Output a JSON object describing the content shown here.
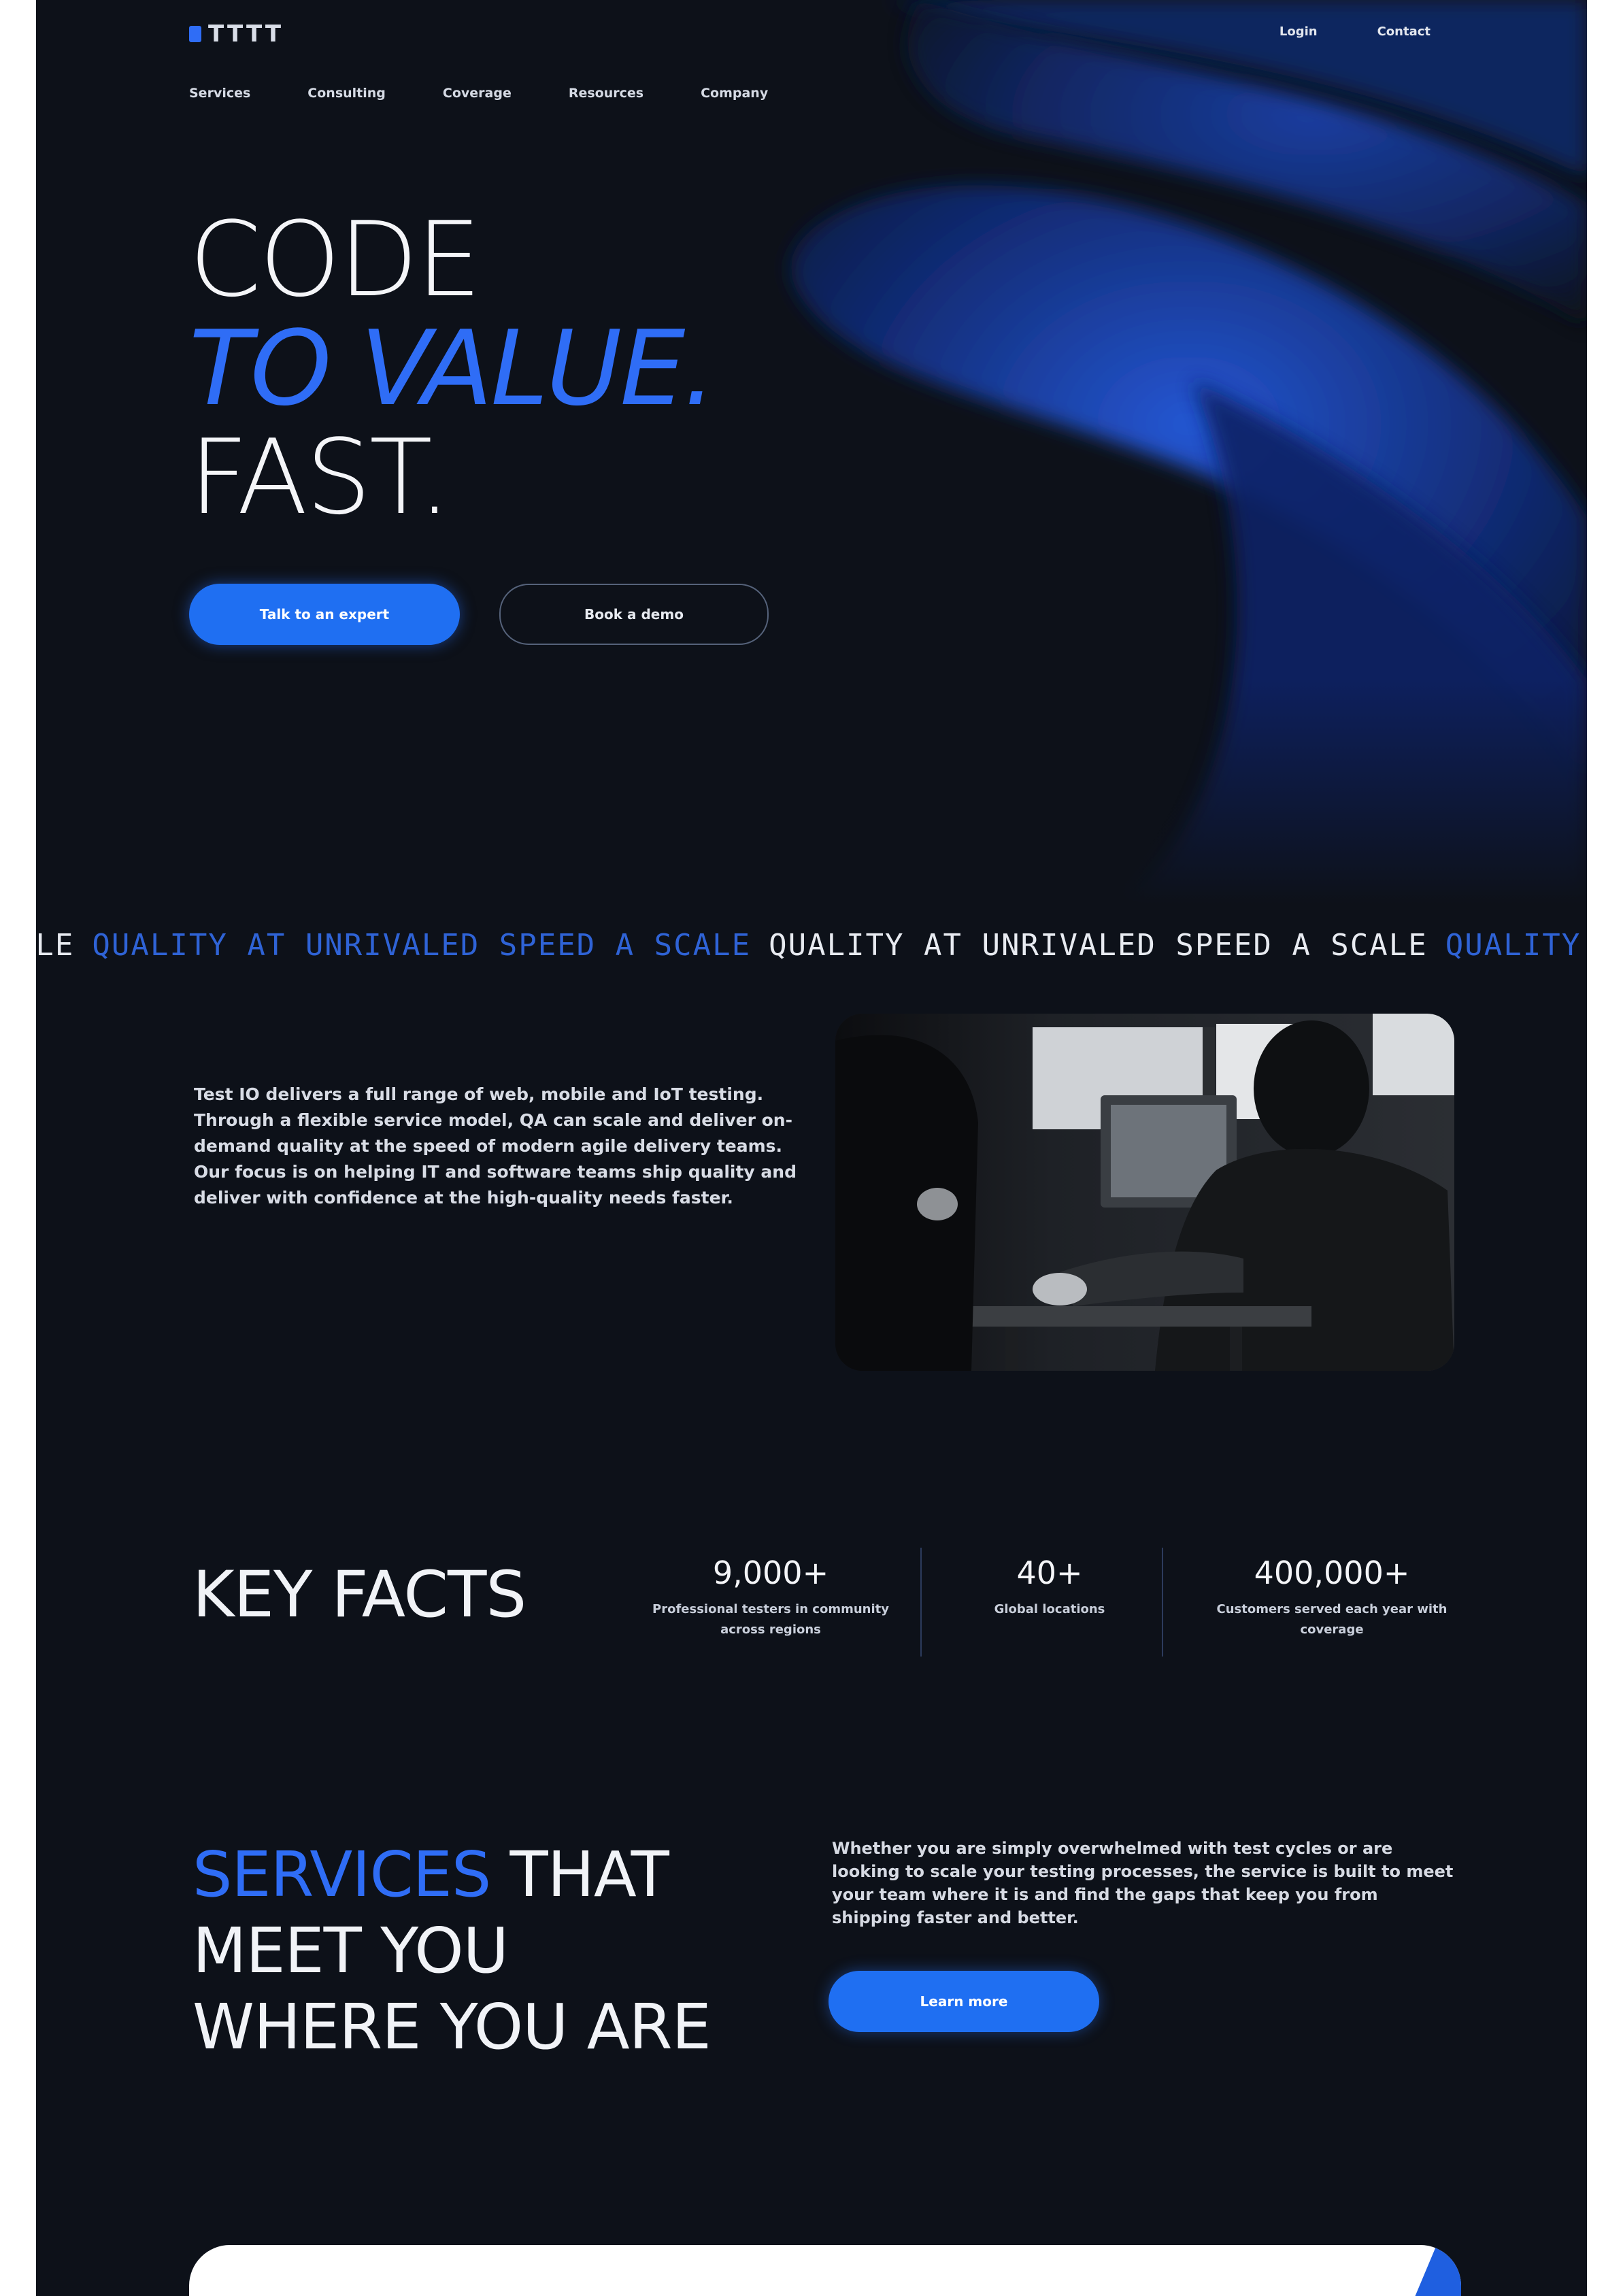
{
  "header": {
    "logo_text": "TTTT",
    "top_links": [
      "Login",
      "Contact"
    ],
    "nav": [
      "Services",
      "Consulting",
      "Coverage",
      "Resources",
      "Company"
    ]
  },
  "hero": {
    "line1": "CODE",
    "line2": "TO VALUE.",
    "line3": "FAST.",
    "primary_cta": "Talk to an expert",
    "secondary_cta": "Book a demo"
  },
  "ticker": {
    "segments": [
      {
        "text": "D A SCALE",
        "tone": "white"
      },
      {
        "text": "QUALITY AT UNRIVALED SPEED A SCALE",
        "tone": "blue"
      },
      {
        "text": "QUALITY AT UNRIVALED SPEED A SCALE",
        "tone": "white"
      },
      {
        "text": "QUALITY AT U",
        "tone": "blue"
      }
    ]
  },
  "about": {
    "paragraphs": [
      "Test IO delivers a full range of web, mobile and IoT testing. Through a flexible service model, QA can scale and deliver on-demand quality at the speed of modern agile delivery teams.",
      "Our focus is on helping IT and software teams ship quality and deliver with confidence at the high-quality needs faster."
    ],
    "photo_alt": "person working at a computer monitor"
  },
  "facts": {
    "title": "KEY FACTS",
    "items": [
      {
        "value": "9,000+",
        "label": "Professional testers in community across regions"
      },
      {
        "value": "40+",
        "label": "Global locations"
      },
      {
        "value": "400,000+",
        "label": "Customers served each year with coverage"
      }
    ]
  },
  "services": {
    "title_accent": "SERVICES",
    "title_rest_1": " THAT",
    "title_line2": "MEET YOU",
    "title_line3": "WHERE YOU ARE",
    "text": "Whether you are simply overwhelmed with test cycles or are looking to scale your testing processes, the service is built to meet your team where it is and find the gaps that keep you from shipping faster and better.",
    "cta": "Learn more"
  },
  "colors": {
    "background": "#0d1119",
    "accent": "#2f6df6",
    "button": "#1f6ff2"
  }
}
